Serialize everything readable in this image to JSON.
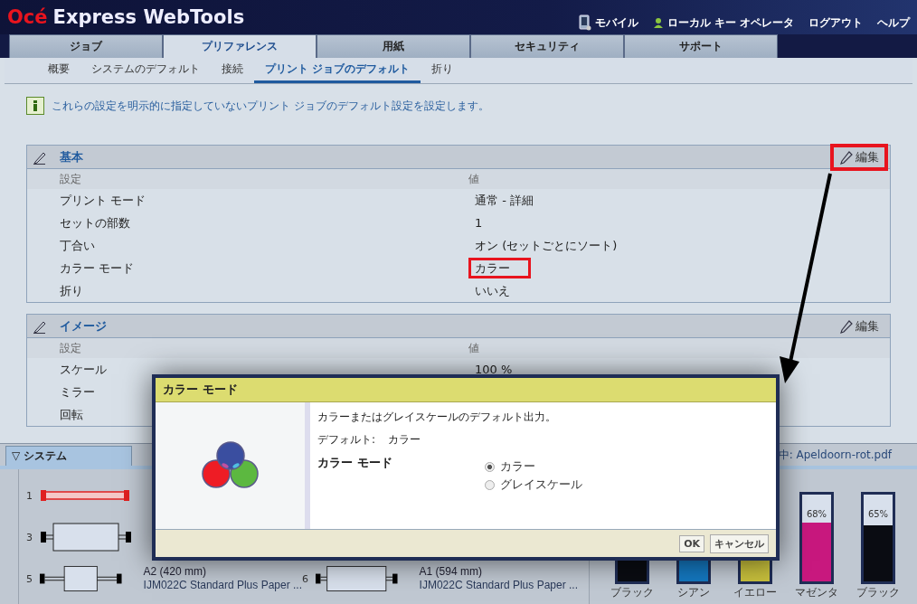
{
  "header": {
    "logo_brand": "Océ",
    "logo_product": "Express WebTools",
    "links": [
      {
        "label": "モバイル",
        "kind": "mobile"
      },
      {
        "label": "ローカル キー オペレータ",
        "kind": "user"
      },
      {
        "label": "ログアウト",
        "kind": "plain"
      },
      {
        "label": "ヘルプ",
        "kind": "plain"
      }
    ]
  },
  "tabs": [
    {
      "label": "ジョブ",
      "selected": false
    },
    {
      "label": "プリファレンス",
      "selected": true
    },
    {
      "label": "用紙",
      "selected": false
    },
    {
      "label": "セキュリティ",
      "selected": false
    },
    {
      "label": "サポート",
      "selected": false
    }
  ],
  "subtabs": [
    {
      "label": "概要",
      "selected": false
    },
    {
      "label": "システムのデフォルト",
      "selected": false
    },
    {
      "label": "接続",
      "selected": false
    },
    {
      "label": "プリント ジョブのデフォルト",
      "selected": true
    },
    {
      "label": "折り",
      "selected": false
    }
  ],
  "info": "これらの設定を明示的に指定していないプリント ジョブのデフォルト設定を設定します。",
  "sections": [
    {
      "title": "基本",
      "edit": "編集",
      "edit_highlighted": true,
      "col_setting": "設定",
      "col_value": "値",
      "rows": [
        {
          "setting": "プリント モード",
          "value": "通常 - 詳細",
          "highlighted": false
        },
        {
          "setting": "セットの部数",
          "value": "1",
          "highlighted": false
        },
        {
          "setting": "丁合い",
          "value": "オン (セットごとにソート)",
          "highlighted": false
        },
        {
          "setting": "カラー モード",
          "value": "カラー",
          "highlighted": true
        },
        {
          "setting": "折り",
          "value": "いいえ",
          "highlighted": false
        }
      ]
    },
    {
      "title": "イメージ",
      "edit": "編集",
      "edit_highlighted": false,
      "col_setting": "設定",
      "col_value": "値",
      "rows": [
        {
          "setting": "スケール",
          "value": "100 %",
          "highlighted": false
        },
        {
          "setting": "ミラー"
        },
        {
          "setting": "回転"
        }
      ]
    }
  ],
  "system": {
    "toggle": "▽",
    "title": "システム",
    "status": "中: Apeldoorn-rot.pdf",
    "roll_rows": [
      [
        {
          "number": "1",
          "kind": "empty"
        }
      ],
      [
        {
          "number": "3",
          "kind": "wide"
        }
      ],
      [
        {
          "number": "5",
          "kind": "narrow",
          "size": "A2 (420 mm)",
          "media": "IJM022C Standard Plus Paper ..."
        },
        {
          "number": "6",
          "kind": "wide",
          "size": "A1 (594 mm)",
          "media": "IJM022C Standard Plus Paper ..."
        }
      ]
    ],
    "inks": [
      {
        "label": "ブラック",
        "color": "#0a0c12"
      },
      {
        "label": "シアン",
        "color": "#1478c0"
      },
      {
        "label": "イエロー",
        "color": "#c8c03c"
      },
      {
        "label": "マゼンタ",
        "color": "#c8187e",
        "level": 0.68,
        "reading": "68%"
      },
      {
        "label": "ブラック",
        "color": "#0a0c12",
        "level": 0.65,
        "reading": "65%"
      }
    ]
  },
  "dialog": {
    "title": "カラー モード",
    "description": "カラーまたはグレイスケールのデフォルト出力。",
    "default_label": "デフォルト:",
    "default_value": "カラー",
    "field_label": "カラー モード",
    "options": [
      {
        "label": "カラー",
        "selected": true
      },
      {
        "label": "グレイスケール",
        "selected": false
      }
    ],
    "buttons": [
      "OK",
      "キャンセル"
    ]
  }
}
